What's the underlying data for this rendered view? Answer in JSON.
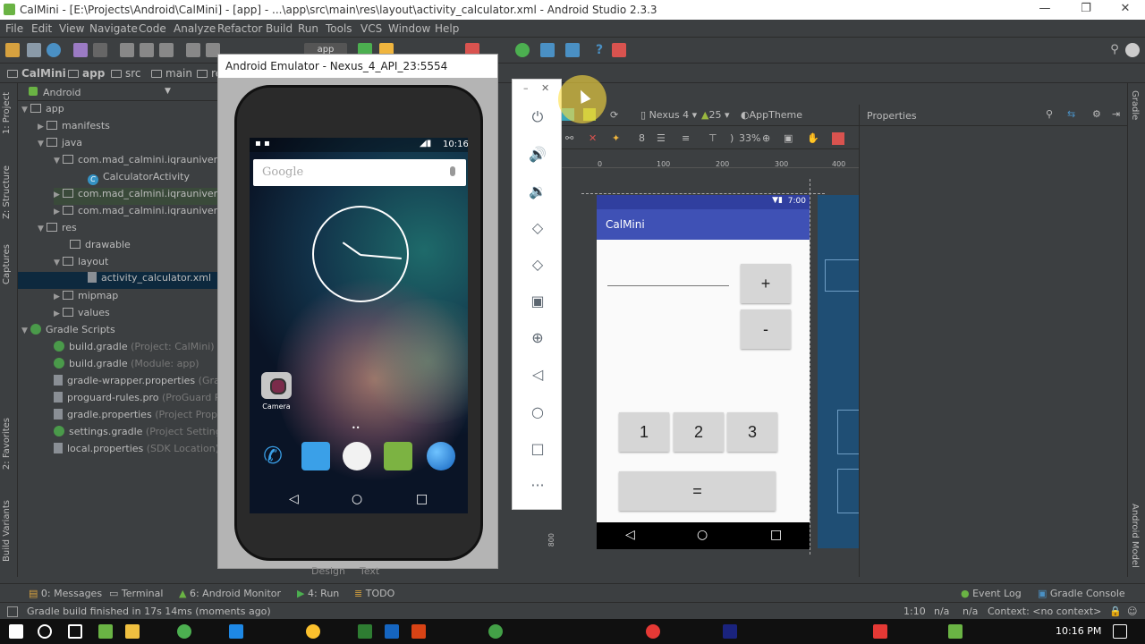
{
  "window": {
    "title": "CalMini - [E:\\Projects\\Android\\CalMini] - [app] - ...\\app\\src\\main\\res\\layout\\activity_calculator.xml - Android Studio 2.3.3",
    "minimize": "—",
    "maximize": "❐",
    "close": "✕"
  },
  "menu": [
    "File",
    "Edit",
    "View",
    "Navigate",
    "Code",
    "Analyze",
    "Refactor",
    "Build",
    "Run",
    "Tools",
    "VCS",
    "Window",
    "Help"
  ],
  "toolbar": {
    "run_config": "app"
  },
  "breadcrumbs": [
    "CalMini",
    "app",
    "src",
    "main",
    "re"
  ],
  "project": {
    "view_mode": "Android",
    "tree": [
      {
        "label": "app",
        "extra": ""
      },
      {
        "label": "manifests",
        "extra": ""
      },
      {
        "label": "java",
        "extra": ""
      },
      {
        "label": "com.mad_calmini.iqrauniversity",
        "extra": ""
      },
      {
        "label": "CalculatorActivity",
        "extra": ""
      },
      {
        "label": "com.mad_calmini.iqrauniversity",
        "extra": ""
      },
      {
        "label": "com.mad_calmini.iqrauniversity",
        "extra": ""
      },
      {
        "label": "res",
        "extra": ""
      },
      {
        "label": "drawable",
        "extra": ""
      },
      {
        "label": "layout",
        "extra": ""
      },
      {
        "label": "activity_calculator.xml",
        "extra": ""
      },
      {
        "label": "mipmap",
        "extra": ""
      },
      {
        "label": "values",
        "extra": ""
      },
      {
        "label": "Gradle Scripts",
        "extra": ""
      },
      {
        "label": "build.gradle",
        "extra": "(Project: CalMini)"
      },
      {
        "label": "build.gradle",
        "extra": "(Module: app)"
      },
      {
        "label": "gradle-wrapper.properties",
        "extra": "(Gradle"
      },
      {
        "label": "proguard-rules.pro",
        "extra": "(ProGuard Ru"
      },
      {
        "label": "gradle.properties",
        "extra": "(Project Propert"
      },
      {
        "label": "settings.gradle",
        "extra": "(Project Settings)"
      },
      {
        "label": "local.properties",
        "extra": "(SDK Location)"
      }
    ]
  },
  "left_tabs": [
    "1: Project",
    "Z: Structure",
    "Captures",
    "2: Favorites",
    "Build Variants"
  ],
  "right_tabs": [
    "Gradle",
    "Android Model"
  ],
  "emulator": {
    "title": "Android Emulator - Nexus_4_API_23:5554",
    "status_time": "10:16",
    "search_placeholder": "Google",
    "camera_label": "Camera"
  },
  "designer": {
    "device": "Nexus 4",
    "api": "25",
    "theme": "AppTheme",
    "zoom": "33%",
    "margin": "8",
    "ruler": [
      "0",
      "100",
      "200",
      "300",
      "400"
    ],
    "ruler_left": "800",
    "preview": {
      "status_time": "7:00",
      "app_title": "CalMini",
      "buttons": [
        "+",
        "-",
        "1",
        "2",
        "3",
        "="
      ]
    }
  },
  "properties": {
    "title": "Properties"
  },
  "editor_tabs": [
    "Design",
    "Text"
  ],
  "bottom_tools": [
    "0: Messages",
    "Terminal",
    "6: Android Monitor",
    "4: Run",
    "TODO",
    "Event Log",
    "Gradle Console"
  ],
  "status": {
    "message": "Gradle build finished in 17s 14ms (moments ago)",
    "position": "1:10",
    "na1": "n/a",
    "na2": "n/a",
    "context": "Context: <no context>"
  },
  "taskbar": {
    "time": "10:16 PM"
  }
}
